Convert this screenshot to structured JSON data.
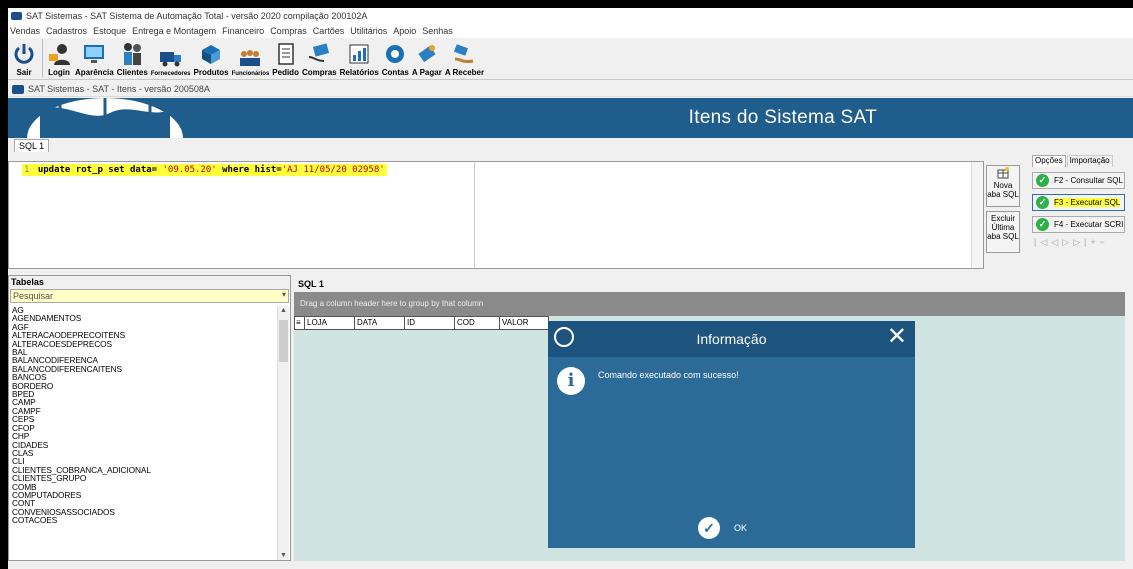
{
  "window": {
    "title": "SAT Sistemas - SAT Sistema de Automação Total - versão 2020 compilação 200102A"
  },
  "menu": [
    "Vendas",
    "Cadastros",
    "Estoque",
    "Entrega e Montagem",
    "Financeiro",
    "Compras",
    "Cartões",
    "Utilitários",
    "Apoio",
    "Senhas"
  ],
  "toolbar": [
    {
      "label": "Sair",
      "icon": "power-icon"
    },
    {
      "label": "Login",
      "icon": "login-icon"
    },
    {
      "label": "Aparência",
      "icon": "monitor-icon"
    },
    {
      "label": "Clientes",
      "icon": "clients-icon"
    },
    {
      "label": "Fornecedores",
      "icon": "truck-icon"
    },
    {
      "label": "Produtos",
      "icon": "boxes-icon"
    },
    {
      "label": "Funcionários",
      "icon": "staff-icon"
    },
    {
      "label": "Pedido",
      "icon": "order-icon"
    },
    {
      "label": "Compras",
      "icon": "purchase-icon"
    },
    {
      "label": "Relatórios",
      "icon": "report-icon"
    },
    {
      "label": "Contas",
      "icon": "accounts-icon"
    },
    {
      "label": "A Pagar",
      "icon": "pay-icon"
    },
    {
      "label": "A Receber",
      "icon": "receive-icon"
    }
  ],
  "subwindow": {
    "title": "SAT Sistemas - SAT - Itens - versão 200508A"
  },
  "banner": {
    "title": "Itens do Sistema SAT"
  },
  "editor": {
    "tab": "SQL 1",
    "line_number": "1",
    "kw1": "update",
    "table": "rot_p",
    "kw2": "set",
    "assign": "data=",
    "value": "'09.05.20'",
    "kw3": "where",
    "cond": "hist=",
    "cond_value": "'AJ 11/05/20 02958'"
  },
  "side_buttons": {
    "new_tab": "Nova aba SQL",
    "delete_tab": "Excluir Última aba SQL"
  },
  "options": {
    "tabs": [
      "Opções",
      "Importação"
    ],
    "f2": "F2 - Consultar SQL",
    "f3": "F3 - Executar SQL",
    "f4": "F4 - Executar SCRIPT"
  },
  "tables_panel": {
    "title": "Tabelas",
    "search_placeholder": "Pesquisar",
    "items": [
      "AG",
      "AGENDAMENTOS",
      "AGF",
      "ALTERACAODEPRECOITENS",
      "ALTERACOESDEPRECOS",
      "BAL",
      "BALANCODIFERENCA",
      "BALANCODIFERENCAITENS",
      "BANCOS",
      "BORDERO",
      "BPED",
      "CAMP",
      "CAMPF",
      "CEPS",
      "CFOP",
      "CHP",
      "CIDADES",
      "CLAS",
      "CLI",
      "CLIENTES_COBRANCA_ADICIONAL",
      "CLIENTES_GRUPO",
      "COMB",
      "COMPUTADORES",
      "CONT",
      "CONVENIOSASSOCIADOS",
      "COTACOES"
    ]
  },
  "result": {
    "title": "SQL 1",
    "group_hint": "Drag a column header here to group by that column",
    "columns": [
      "LOJA",
      "DATA",
      "ID",
      "COD",
      "VALOR"
    ]
  },
  "dialog": {
    "title": "Informação",
    "message": "Comando executado com sucesso!",
    "ok": "OK"
  },
  "colors": {
    "banner": "#1f5d8c",
    "dialog": "#2c6b98",
    "highlight": "#ffff3a",
    "grid_bg": "#cfe3e0"
  }
}
